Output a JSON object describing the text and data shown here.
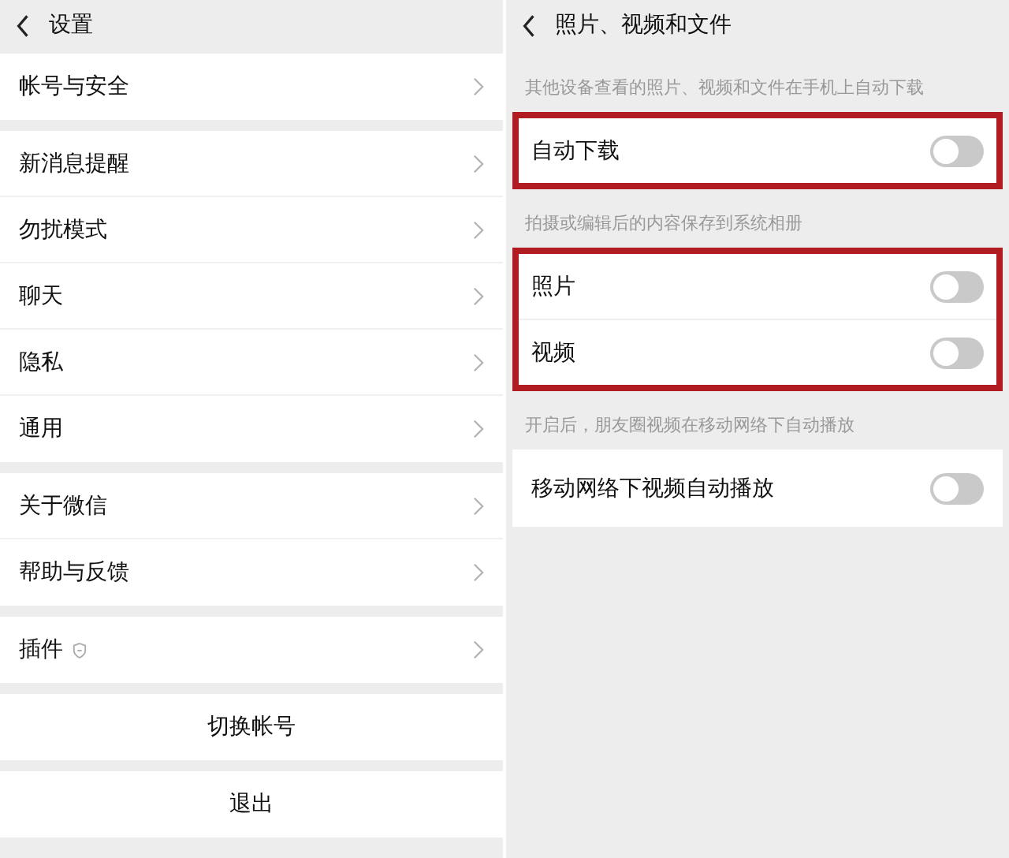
{
  "left": {
    "title": "设置",
    "groups": [
      {
        "items": [
          {
            "label": "帐号与安全",
            "badge": false
          }
        ]
      },
      {
        "items": [
          {
            "label": "新消息提醒",
            "badge": false
          },
          {
            "label": "勿扰模式",
            "badge": false
          },
          {
            "label": "聊天",
            "badge": false
          },
          {
            "label": "隐私",
            "badge": false
          },
          {
            "label": "通用",
            "badge": false
          }
        ]
      },
      {
        "items": [
          {
            "label": "关于微信",
            "badge": false
          },
          {
            "label": "帮助与反馈",
            "badge": false
          }
        ]
      },
      {
        "items": [
          {
            "label": "插件",
            "badge": true
          }
        ]
      }
    ],
    "buttons": [
      "切换帐号",
      "退出"
    ]
  },
  "right": {
    "title": "照片、视频和文件",
    "sections": [
      {
        "caption": "其他设备查看的照片、视频和文件在手机上自动下载",
        "highlighted": true,
        "items": [
          {
            "label": "自动下载",
            "on": false
          }
        ]
      },
      {
        "caption": "拍摄或编辑后的内容保存到系统相册",
        "highlighted": true,
        "items": [
          {
            "label": "照片",
            "on": false
          },
          {
            "label": "视频",
            "on": false
          }
        ]
      },
      {
        "caption": "开启后，朋友圈视频在移动网络下自动播放",
        "highlighted": false,
        "items": [
          {
            "label": "移动网络下视频自动播放",
            "on": false
          }
        ]
      }
    ]
  }
}
